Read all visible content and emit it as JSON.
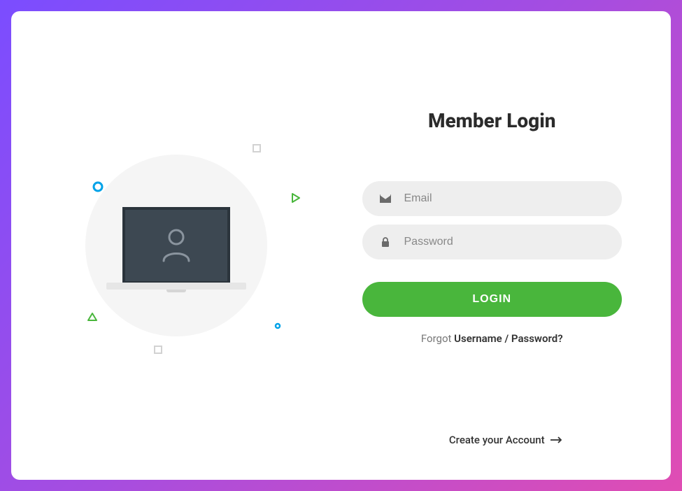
{
  "title": "Member Login",
  "form": {
    "email_placeholder": "Email",
    "password_placeholder": "Password",
    "login_button": "LOGIN"
  },
  "forgot": {
    "prefix": "Forgot ",
    "link": "Username / Password?"
  },
  "create_account": "Create your Account",
  "colors": {
    "accent_green": "#49b63c",
    "accent_blue": "#00a2e8"
  }
}
